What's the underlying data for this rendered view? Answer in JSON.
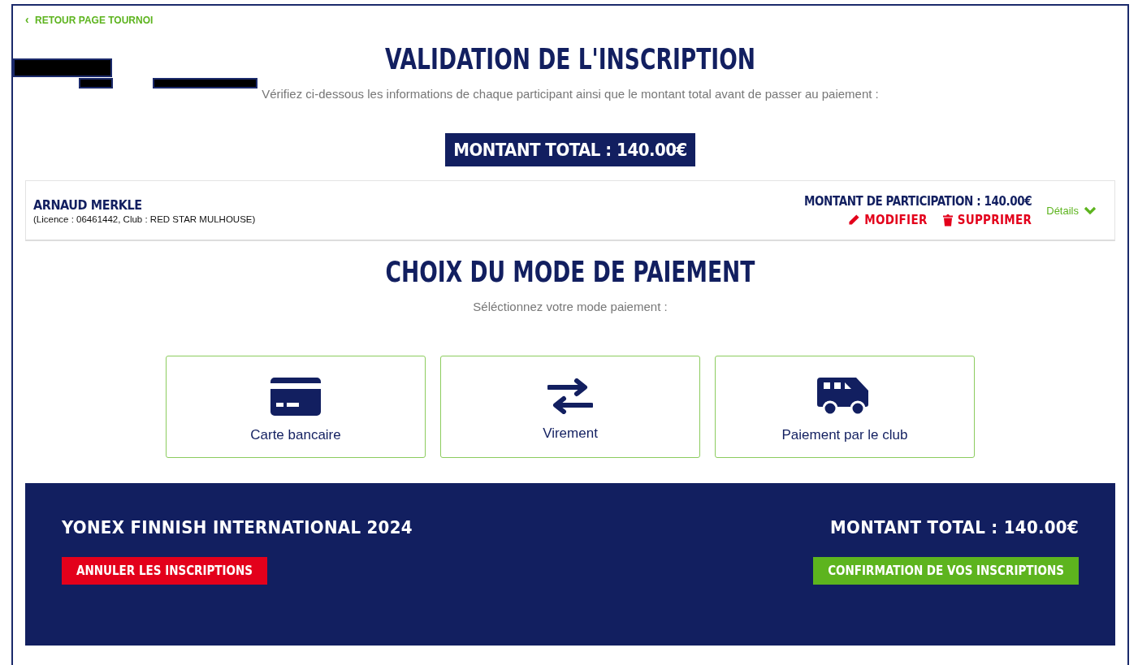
{
  "back_link": {
    "icon": "‹",
    "label": "RETOUR PAGE TOURNOI"
  },
  "title": "VALIDATION DE L'INSCRIPTION",
  "intro": "Vérifiez ci-dessous les informations de chaque participant ainsi que le montant total avant de passer au paiement :",
  "total_badge": "MONTANT TOTAL : 140.00€",
  "participants": [
    {
      "name": "ARNAUD MERKLE",
      "details": "(Licence : 06461442, Club : RED STAR MULHOUSE)",
      "amount": "MONTANT DE PARTICIPATION : 140.00€",
      "edit": "MODIFIER",
      "delete": "SUPPRIMER",
      "toggle": "Détails",
      "expanded": false
    }
  ],
  "payment": {
    "title": "CHOIX DU MODE DE PAIEMENT",
    "subtitle": "Séléctionnez votre mode paiement :",
    "options": [
      {
        "kind": "card",
        "label": "Carte bancaire",
        "selected": false
      },
      {
        "kind": "transfer",
        "label": "Virement",
        "selected": false
      },
      {
        "kind": "van",
        "label": "Paiement par le club",
        "selected": false
      }
    ]
  },
  "footer": {
    "tournament": "YONEX FINNISH INTERNATIONAL 2024",
    "total": "MONTANT TOTAL : 140.00€",
    "cancel": "ANNULER LES INSCRIPTIONS",
    "confirm": "CONFIRMATION DE VOS INSCRIPTIONS"
  }
}
